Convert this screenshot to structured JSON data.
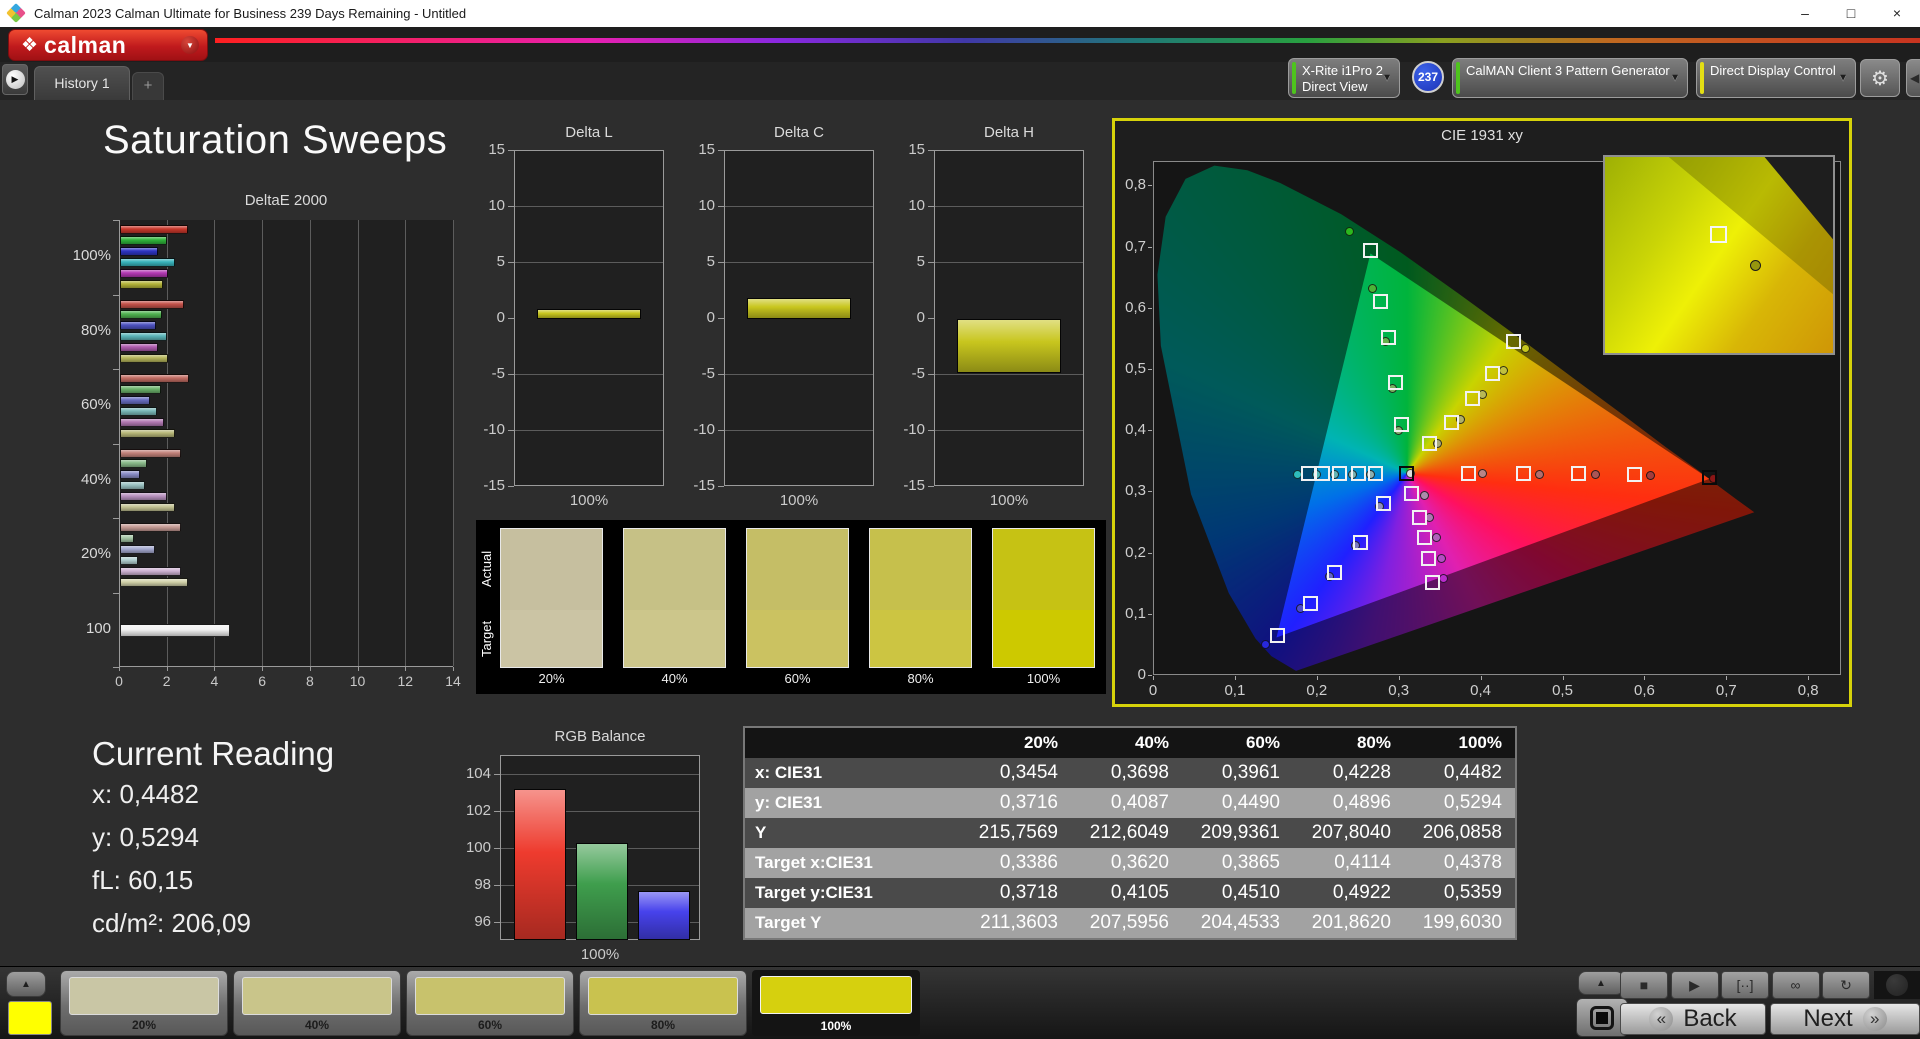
{
  "titlebar": {
    "title": "Calman 2023 Calman Ultimate for Business 239 Days Remaining  - Untitled",
    "minimize": "–",
    "maximize": "□",
    "close": "×"
  },
  "logo": {
    "text": "calman"
  },
  "tabs": {
    "history": "History 1",
    "add": "+"
  },
  "icons": {
    "logo_diamond": "❖",
    "caret_down": "▼",
    "tab_arrow": "▶",
    "gear": "⚙",
    "prev_arrow": "◀",
    "up_arrow": "▲",
    "back_chevrons": "«",
    "next_chevrons": "»"
  },
  "device_bar": {
    "meter_line1": "X-Rite i1Pro 2",
    "meter_line2": "Direct View",
    "meter_status_color": "#4ec41d",
    "badge": "237",
    "badge_color": "#2847d8",
    "pattern_generator": "CalMAN Client 3 Pattern Generator",
    "pattern_status_color": "#4ec41d",
    "display_control": "Direct Display Control",
    "display_status_color": "#e3de14"
  },
  "page_title": "Saturation Sweeps",
  "current_reading": {
    "title": "Current Reading",
    "lines": [
      "x: 0,4482",
      "y: 0,5294",
      "fL: 60,15",
      "cd/m²: 206,09"
    ]
  },
  "swatch_compare": {
    "row_labels": [
      "Actual",
      "Target"
    ],
    "levels": [
      "20%",
      "40%",
      "60%",
      "80%",
      "100%"
    ],
    "actual_colors": [
      "#c6bf9f",
      "#c6c186",
      "#c5be66",
      "#c6c04c",
      "#c6c214"
    ],
    "target_colors": [
      "#cbc4a4",
      "#ccc68b",
      "#cbc261",
      "#ccc542",
      "#cdc900"
    ]
  },
  "table": {
    "header": [
      "",
      "20%",
      "40%",
      "60%",
      "80%",
      "100%"
    ],
    "rows": [
      {
        "label": "x: CIE31",
        "values": [
          "0,3454",
          "0,3698",
          "0,3961",
          "0,4228",
          "0,4482"
        ]
      },
      {
        "label": "y: CIE31",
        "values": [
          "0,3716",
          "0,4087",
          "0,4490",
          "0,4896",
          "0,5294"
        ]
      },
      {
        "label": "Y",
        "values": [
          "215,7569",
          "212,6049",
          "209,9361",
          "207,8040",
          "206,0858"
        ]
      },
      {
        "label": "Target x:CIE31",
        "values": [
          "0,3386",
          "0,3620",
          "0,3865",
          "0,4114",
          "0,4378"
        ]
      },
      {
        "label": "Target y:CIE31",
        "values": [
          "0,3718",
          "0,4105",
          "0,4510",
          "0,4922",
          "0,5359"
        ]
      },
      {
        "label": "Target Y",
        "values": [
          "211,3603",
          "207,5956",
          "204,4533",
          "201,8620",
          "199,6030"
        ]
      }
    ],
    "row_colors": [
      "#4a4a4a",
      "#a2a2a2",
      "#4a4a4a",
      "#a2a2a2",
      "#4a4a4a",
      "#a2a2a2"
    ],
    "header_color": "#141414"
  },
  "chart_data": {
    "deltae": {
      "type": "bar",
      "orientation": "horizontal",
      "title": "DeltaE 2000",
      "xlim": [
        0,
        14
      ],
      "xticks": [
        0,
        2,
        4,
        6,
        8,
        10,
        12,
        14
      ],
      "groups": [
        {
          "label": "100%",
          "bars": [
            [
              "#c8372b",
              2.85
            ],
            [
              "#2fb33a",
              1.95
            ],
            [
              "#2e35c4",
              1.6
            ],
            [
              "#38b3bc",
              2.3
            ],
            [
              "#b338b3",
              2.0
            ],
            [
              "#b3b338",
              1.8
            ]
          ]
        },
        {
          "label": "80%",
          "bars": [
            [
              "#c4524a",
              2.7
            ],
            [
              "#4fb24f",
              1.75
            ],
            [
              "#4d52c0",
              1.5
            ],
            [
              "#5cb6ba",
              1.95
            ],
            [
              "#ae5cae",
              1.6
            ],
            [
              "#b6b65c",
              2.0
            ]
          ]
        },
        {
          "label": "60%",
          "bars": [
            [
              "#c26c63",
              2.9
            ],
            [
              "#6bb26b",
              1.7
            ],
            [
              "#686cc0",
              1.25
            ],
            [
              "#79b8b8",
              1.55
            ],
            [
              "#b279b2",
              1.85
            ],
            [
              "#b8b879",
              2.3
            ]
          ]
        },
        {
          "label": "40%",
          "bars": [
            [
              "#c2827a",
              2.55
            ],
            [
              "#89ba89",
              1.15
            ],
            [
              "#8a8dc6",
              0.85
            ],
            [
              "#9ac2c2",
              1.05
            ],
            [
              "#ba92c0",
              1.95
            ],
            [
              "#c2c292",
              2.3
            ]
          ]
        },
        {
          "label": "20%",
          "bars": [
            [
              "#c69c96",
              2.55
            ],
            [
              "#a6c6a6",
              0.6
            ],
            [
              "#a6aad0",
              1.45
            ],
            [
              "#b2d0d0",
              0.75
            ],
            [
              "#ceb2d2",
              2.55
            ],
            [
              "#d2d2aa",
              2.85
            ]
          ]
        },
        {
          "label": "100",
          "bars": [
            [
              "#f2f2f2",
              4.6
            ]
          ]
        }
      ]
    },
    "delta_l": {
      "type": "bar",
      "title": "Delta L",
      "ylim": [
        -15,
        15
      ],
      "yticks": [
        15,
        10,
        5,
        0,
        -5,
        -10,
        -15
      ],
      "categories": [
        "100%"
      ],
      "values": [
        0.9
      ],
      "color": "#c8c61e"
    },
    "delta_c": {
      "type": "bar",
      "title": "Delta C",
      "ylim": [
        -15,
        15
      ],
      "yticks": [
        15,
        10,
        5,
        0,
        -5,
        -10,
        -15
      ],
      "categories": [
        "100%"
      ],
      "values": [
        1.9
      ],
      "color": "#c8c61e"
    },
    "delta_h": {
      "type": "bar",
      "title": "Delta H",
      "ylim": [
        -15,
        15
      ],
      "yticks": [
        15,
        10,
        5,
        0,
        -5,
        -10,
        -15
      ],
      "categories": [
        "100%"
      ],
      "values": [
        -4.8
      ],
      "color": "#c8c61e"
    },
    "rgb_balance": {
      "type": "bar",
      "title": "RGB Balance",
      "ylim": [
        95,
        105
      ],
      "yticks": [
        104,
        102,
        100,
        98,
        96
      ],
      "categories": [
        "100%"
      ],
      "series": [
        {
          "name": "Red",
          "value": 103.2,
          "color": "#ee3b2e"
        },
        {
          "name": "Green",
          "value": 100.3,
          "color": "#3f9e4d"
        },
        {
          "name": "Blue",
          "value": 97.7,
          "color": "#4742ec"
        }
      ]
    },
    "cie": {
      "type": "scatter",
      "title": "CIE 1931 xy",
      "xlim": [
        0,
        0.84
      ],
      "ylim": [
        0,
        0.84
      ],
      "xticks": [
        "0",
        "0,1",
        "0,2",
        "0,3",
        "0,4",
        "0,5",
        "0,6",
        "0,7",
        "0,8"
      ],
      "yticks": [
        "0",
        "0,1",
        "0,2",
        "0,3",
        "0,4",
        "0,5",
        "0,6",
        "0,7",
        "0,8"
      ],
      "gamut_triangle": [
        [
          0.68,
          0.32
        ],
        [
          0.265,
          0.69
        ],
        [
          0.15,
          0.06
        ]
      ],
      "white_point": {
        "square": [
          0.31,
          0.329
        ],
        "circle": [
          0.314,
          0.329
        ],
        "circle_color": "#dcdcdc"
      },
      "red_primary": {
        "square": [
          0.68,
          0.322
        ],
        "circle": [
          0.684,
          0.321
        ],
        "circle_color": "#8c1616"
      },
      "sweeps": [
        {
          "name": "red",
          "squares": [
            [
              0.385,
              0.33
            ],
            [
              0.452,
              0.33
            ],
            [
              0.52,
              0.329
            ],
            [
              0.588,
              0.328
            ]
          ],
          "circles": [
            [
              0.402,
              0.329
            ],
            [
              0.472,
              0.328
            ],
            [
              0.54,
              0.327
            ],
            [
              0.607,
              0.326
            ]
          ],
          "circle_colors": [
            "#b98585",
            "#b26e6e",
            "#aa5555",
            "#a23c3c"
          ]
        },
        {
          "name": "green",
          "squares": [
            [
              0.303,
              0.41
            ],
            [
              0.296,
              0.478
            ],
            [
              0.288,
              0.552
            ],
            [
              0.278,
              0.61
            ],
            [
              0.266,
              0.693
            ]
          ],
          "circles": [
            [
              0.3,
              0.399
            ],
            [
              0.292,
              0.468
            ],
            [
              0.284,
              0.545
            ],
            [
              0.268,
              0.632
            ],
            [
              0.24,
              0.724
            ]
          ],
          "circle_colors": [
            "#86ae6e",
            "#76b05f",
            "#63b24c",
            "#4cb437",
            "#2cb81e"
          ]
        },
        {
          "name": "blue",
          "squares": [
            [
              0.281,
              0.281
            ],
            [
              0.253,
              0.217
            ],
            [
              0.222,
              0.168
            ],
            [
              0.192,
              0.117
            ],
            [
              0.152,
              0.064
            ]
          ],
          "circles": [
            [
              0.276,
              0.276
            ],
            [
              0.247,
              0.211
            ],
            [
              0.216,
              0.161
            ],
            [
              0.18,
              0.108
            ],
            [
              0.137,
              0.05
            ]
          ],
          "circle_colors": [
            "#8f8fbc",
            "#7a7ac2",
            "#6363c8",
            "#4a4ad2",
            "#2828dd"
          ]
        },
        {
          "name": "cyan",
          "squares": [
            [
              0.272,
              0.329
            ],
            [
              0.251,
              0.329
            ],
            [
              0.228,
              0.329
            ],
            [
              0.207,
              0.329
            ],
            [
              0.19,
              0.329
            ]
          ],
          "circles": [
            [
              0.266,
              0.328
            ],
            [
              0.243,
              0.328
            ],
            [
              0.221,
              0.328
            ],
            [
              0.2,
              0.328
            ],
            [
              0.176,
              0.328
            ]
          ],
          "circle_colors": [
            "#8fb0b0",
            "#7bb2b2",
            "#66b5b5",
            "#50b8b8",
            "#2ebcbc"
          ]
        },
        {
          "name": "magenta",
          "squares": [
            [
              0.316,
              0.296
            ],
            [
              0.325,
              0.258
            ],
            [
              0.331,
              0.225
            ],
            [
              0.336,
              0.19
            ],
            [
              0.341,
              0.151
            ]
          ],
          "circles": [
            [
              0.331,
              0.294
            ],
            [
              0.338,
              0.258
            ],
            [
              0.346,
              0.224
            ],
            [
              0.352,
              0.19
            ],
            [
              0.355,
              0.158
            ]
          ],
          "circle_colors": [
            "#ab8bab",
            "#ad77b3",
            "#b062bb",
            "#b44cc3",
            "#b92ccc"
          ]
        },
        {
          "name": "yellow",
          "squares": [
            [
              0.337,
              0.378
            ],
            [
              0.364,
              0.412
            ],
            [
              0.39,
              0.452
            ],
            [
              0.414,
              0.492
            ],
            [
              0.44,
              0.545
            ]
          ],
          "circles": [
            [
              0.347,
              0.378
            ],
            [
              0.376,
              0.418
            ],
            [
              0.402,
              0.458
            ],
            [
              0.428,
              0.497
            ],
            [
              0.455,
              0.533
            ]
          ],
          "circle_colors": [
            "#aaaa78",
            "#b0b068",
            "#b8b855",
            "#c0c03e",
            "#c6c61e"
          ]
        }
      ],
      "inset": {
        "square_pos": [
          50,
          40
        ],
        "circle_pos": [
          66,
          55
        ],
        "circle_color": "#96960e"
      }
    }
  },
  "bottom_bar": {
    "current_color": "#ffff00",
    "levels": [
      {
        "label": "20%",
        "color": "#c9c6a5",
        "selected": false
      },
      {
        "label": "40%",
        "color": "#c9c58a",
        "selected": false
      },
      {
        "label": "60%",
        "color": "#c8c26c",
        "selected": false
      },
      {
        "label": "80%",
        "color": "#c9c24f",
        "selected": false
      },
      {
        "label": "100%",
        "color": "#d6d00e",
        "selected": true
      }
    ],
    "playback": [
      {
        "name": "stop",
        "glyph": "■"
      },
      {
        "name": "play",
        "glyph": "▶"
      },
      {
        "name": "single-measure",
        "glyph": "[··]"
      },
      {
        "name": "continuous-measure",
        "glyph": "∞"
      },
      {
        "name": "refresh",
        "glyph": "↻"
      }
    ],
    "back": "Back",
    "next": "Next"
  }
}
